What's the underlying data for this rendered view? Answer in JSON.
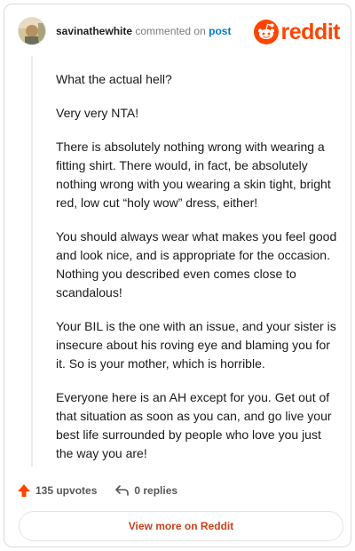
{
  "header": {
    "username": "savinathewhite",
    "commented_on": "commented on",
    "post_link": "post",
    "brand": "reddit"
  },
  "comment": {
    "paragraphs": [
      "What the actual hell?",
      "Very very NTA!",
      "There is absolutely nothing wrong with wearing a fitting shirt. There would, in fact, be absolutely nothing wrong with you wearing a skin tight, bright red, low cut “holy wow” dress, either!",
      "You should always wear what makes you feel good and look nice, and is appropriate for the occasion. Nothing you described even comes close to scandalous!",
      "Your BIL is the one with an issue, and your sister is insecure about his roving eye and blaming you for it. So is your mother, which is horrible.",
      "Everyone here is an AH except for you. Get out of that situation as soon as you can, and go live your best life surrounded by people who love you just the way you are!"
    ]
  },
  "actions": {
    "upvotes": "135 upvotes",
    "replies": "0 replies"
  },
  "footer": {
    "view_more": "View more on Reddit"
  },
  "colors": {
    "brand": "#ff4500",
    "link": "#0079d3"
  },
  "icons": [
    "avatar",
    "reddit-alien-icon",
    "upvote-arrow-icon",
    "reply-arrow-icon"
  ]
}
